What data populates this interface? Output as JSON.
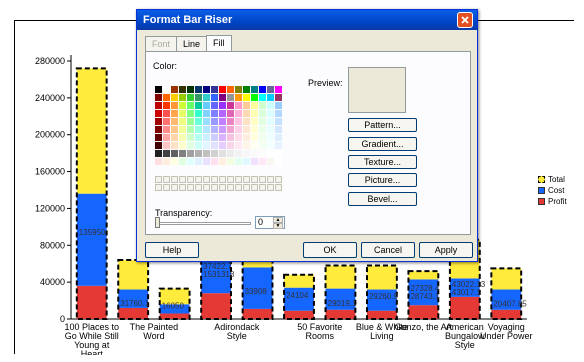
{
  "dialog": {
    "title": "Format Bar Riser",
    "tabs": [
      {
        "label": "Font",
        "state": "disabled"
      },
      {
        "label": "Line",
        "state": "normal"
      },
      {
        "label": "Fill",
        "state": "active"
      }
    ],
    "color_label": "Color:",
    "preview_label": "Preview:",
    "transparency_label": "Transparency:",
    "transparency_value": "0",
    "buttons": {
      "pattern": "Pattern...",
      "gradient": "Gradient...",
      "texture": "Texture...",
      "picture": "Picture...",
      "bevel": "Bevel...",
      "help": "Help",
      "ok": "OK",
      "cancel": "Cancel",
      "apply": "Apply"
    },
    "palette": [
      "#000000",
      "#ffffff",
      "#993300",
      "#333300",
      "#003300",
      "#003366",
      "#000080",
      "#333399",
      "#ff0000",
      "#ff6600",
      "#808000",
      "#008000",
      "#008080",
      "#0000ff",
      "#666699",
      "#ff00ff",
      "#800000",
      "#ff6600",
      "#ffcc00",
      "#99cc00",
      "#33cc33",
      "#339966",
      "#33cccc",
      "#3366ff",
      "#800080",
      "#969696",
      "#ff9900",
      "#ffff00",
      "#00ff00",
      "#00ffff",
      "#00ccff",
      "#993366",
      "#c00000",
      "#ff3300",
      "#ff9933",
      "#ccff33",
      "#66ff66",
      "#00cc99",
      "#66ccff",
      "#6666ff",
      "#9933ff",
      "#cc3399",
      "#ff99cc",
      "#ffcc99",
      "#ffff99",
      "#ccffcc",
      "#ccffff",
      "#99ccff",
      "#cc0000",
      "#ff5050",
      "#ffa64d",
      "#e6ff66",
      "#80ff80",
      "#33ffcc",
      "#80d4ff",
      "#8080ff",
      "#b366ff",
      "#e066b3",
      "#ffb3d9",
      "#ffd9b3",
      "#ffffb3",
      "#d9ffd9",
      "#d9ffff",
      "#b3d9ff",
      "#a00000",
      "#ff7070",
      "#ffb870",
      "#eeff80",
      "#99ff99",
      "#66ffd9",
      "#99ddff",
      "#9999ff",
      "#c080ff",
      "#eb85c2",
      "#ffc4e1",
      "#ffe1c4",
      "#ffffc4",
      "#e1ffe1",
      "#e1ffff",
      "#c4e1ff",
      "#800000",
      "#ff8c8c",
      "#ffc68c",
      "#f2ff99",
      "#b3ffb3",
      "#99ffe6",
      "#b3e6ff",
      "#b3b3ff",
      "#cc99ff",
      "#f0a3d1",
      "#ffd1e8",
      "#ffe8d1",
      "#ffffd1",
      "#e8ffe8",
      "#e8ffff",
      "#d1e8ff",
      "#600000",
      "#ffa8a8",
      "#ffd4a8",
      "#f7ffb3",
      "#ccffcc",
      "#b3fff0",
      "#ccf0ff",
      "#ccccff",
      "#d9b3ff",
      "#f5c2e0",
      "#ffdde9",
      "#ffeedd",
      "#ffffdd",
      "#eeffee",
      "#eeffff",
      "#ddeeff",
      "#400000",
      "#ffc4c4",
      "#ffe2c4",
      "#fbffcc",
      "#e0ffe0",
      "#ccfff5",
      "#e0f5ff",
      "#e0e0ff",
      "#e6ccff",
      "#f8d6ea",
      "#ffe8f2",
      "#fff4e8",
      "#fffff0",
      "#f4fff4",
      "#f4ffff",
      "#e8f2ff",
      "#202020",
      "#404040",
      "#606060",
      "#808080",
      "#a0a0a0",
      "#b0b0b0",
      "#c0c0c0",
      "#d0d0d0",
      "#e0e0e0",
      "#ebebeb",
      "#f2f2f2",
      "#f7f7f7",
      "#fafafa",
      "#fcfcfc",
      "#fefefe",
      "#ffffff",
      "#ffe0e0",
      "#ffeedd",
      "#ffffe0",
      "#e0ffe0",
      "#e0ffff",
      "#e0f0ff",
      "#e8e0ff",
      "#ffe0f0",
      "#fff0e0",
      "#f0ffe0",
      "#e0fff0",
      "#e0f8ff",
      "#f0e0ff",
      "#ffe8f8",
      "#f8f8f0",
      "#ffffff"
    ]
  },
  "legend": [
    {
      "label": "Total",
      "color": "#ffeb3b",
      "dashed": true
    },
    {
      "label": "Cost",
      "color": "#1565ff",
      "dashed": false
    },
    {
      "label": "Profit",
      "color": "#e53935",
      "dashed": false
    }
  ],
  "chart_data": {
    "type": "bar",
    "ylim": [
      0,
      280000
    ],
    "yticks": [
      "0",
      "40000",
      "80000",
      "120000",
      "160000",
      "200000",
      "240000",
      "280000"
    ],
    "categories": [
      [
        "100 Places to",
        "Go While Still",
        "Young at",
        "Heart"
      ],
      [
        "The Painted",
        "Word"
      ],
      [
        "Adirondack",
        "Style"
      ],
      [
        "50 Favorite",
        "Rooms"
      ],
      [
        "Blue & White",
        "Living"
      ],
      [
        "Gonzo, the Art"
      ],
      [
        "American",
        "Bungalow",
        "Style"
      ],
      [
        "Voyaging",
        "Under Power"
      ]
    ],
    "series": [
      {
        "name": "Profit",
        "values": [
          36000,
          12000,
          6000,
          28000,
          11000,
          9000,
          10000,
          9000,
          15000,
          24000,
          10000
        ]
      },
      {
        "name": "Cost",
        "values": [
          100000,
          20000,
          10000,
          48000,
          45000,
          25000,
          23000,
          23000,
          28000,
          20000,
          22000
        ]
      },
      {
        "name": "Total",
        "values": [
          272000,
          64000,
          33000,
          76000,
          68000,
          48000,
          58000,
          58000,
          52000,
          86000,
          55000
        ]
      }
    ],
    "data_labels": [
      "135950",
      "31760",
      "16050",
      "",
      "",
      "",
      "",
      "",
      "",
      "",
      "20407"
    ],
    "visible_labels": [
      {
        "bar": 0,
        "text": "135950"
      },
      {
        "bar": 1,
        "text": "31760.1"
      },
      {
        "bar": 2,
        "text": "16050"
      },
      {
        "bar": 3,
        "text": "1531318"
      },
      {
        "bar": 3,
        "text": "37422.7"
      },
      {
        "bar": 4,
        "text": "33908"
      },
      {
        "bar": 5,
        "text": "24104"
      },
      {
        "bar": 6,
        "text": "29019.1"
      },
      {
        "bar": 7,
        "text": "29260.9"
      },
      {
        "bar": 8,
        "text": "28743.1"
      },
      {
        "bar": 8,
        "text": "27328.4"
      },
      {
        "bar": 9,
        "text": "43017.1"
      },
      {
        "bar": 9,
        "text": "43022.13"
      },
      {
        "bar": 10,
        "text": "20407.85"
      }
    ]
  }
}
